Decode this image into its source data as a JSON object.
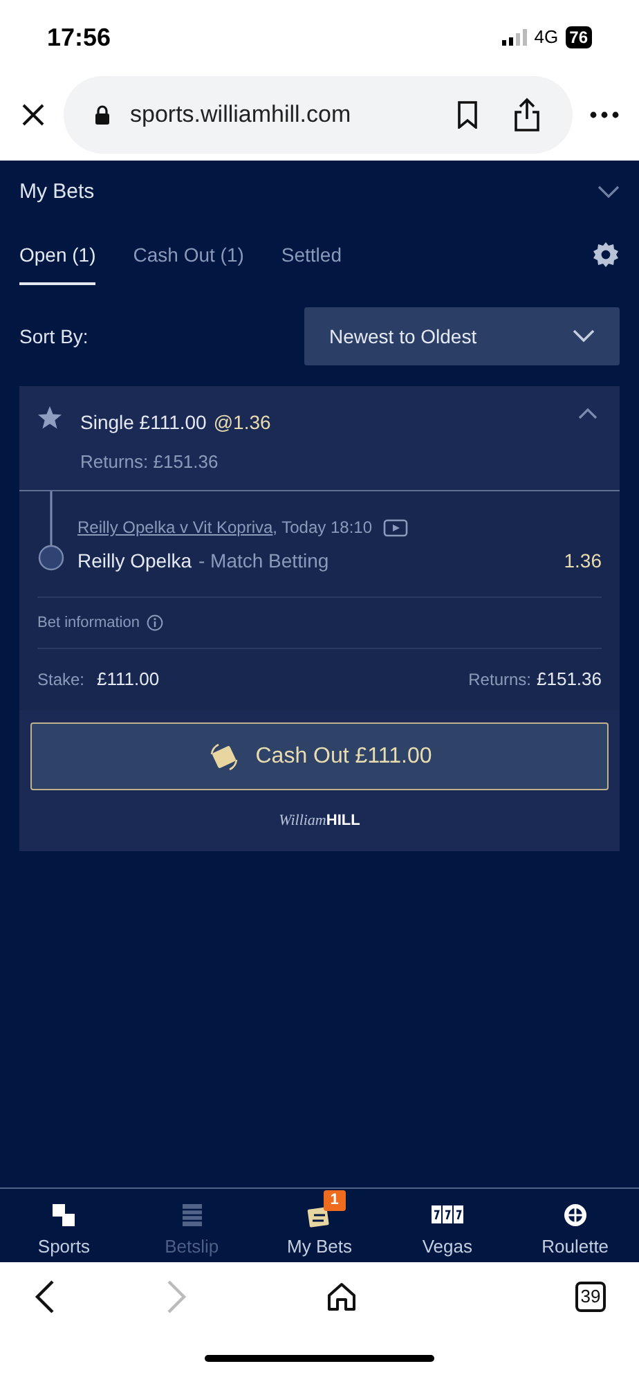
{
  "status_bar": {
    "time": "17:56",
    "network": "4G",
    "battery": "76"
  },
  "browser": {
    "url": "sports.williamhill.com",
    "tab_count": "39"
  },
  "header": {
    "title": "My Bets"
  },
  "tabs": [
    {
      "label": "Open (1)",
      "selected": true
    },
    {
      "label": "Cash Out (1)",
      "selected": false
    },
    {
      "label": "Settled",
      "selected": false
    }
  ],
  "sort": {
    "label": "Sort By:",
    "value": "Newest to Oldest"
  },
  "bet": {
    "type": "Single £111.00",
    "odds": "@1.36",
    "returns": "Returns: £151.36",
    "expanded": true,
    "event": "Reilly Opelka v Vit Kopriva",
    "time": ", Today 18:10",
    "selection": "Reilly Opelka",
    "market": "- Match Betting",
    "price": "1.36",
    "info_label": "Bet information",
    "stake_label": "Stake:",
    "stake": "£111.00",
    "returns_label": "Returns:",
    "returns_value": "£151.36",
    "cash_out": "Cash Out £111.00",
    "logo_script": "William",
    "logo_bold": "HILL"
  },
  "bottom_nav": [
    {
      "label": "Sports",
      "kind": "az",
      "disabled": false
    },
    {
      "label": "Betslip",
      "kind": "slip",
      "disabled": true
    },
    {
      "label": "My Bets",
      "kind": "bets",
      "disabled": false,
      "badge": "1"
    },
    {
      "label": "Vegas",
      "kind": "slots",
      "disabled": false
    },
    {
      "label": "Roulette",
      "kind": "wheel",
      "disabled": false
    }
  ]
}
